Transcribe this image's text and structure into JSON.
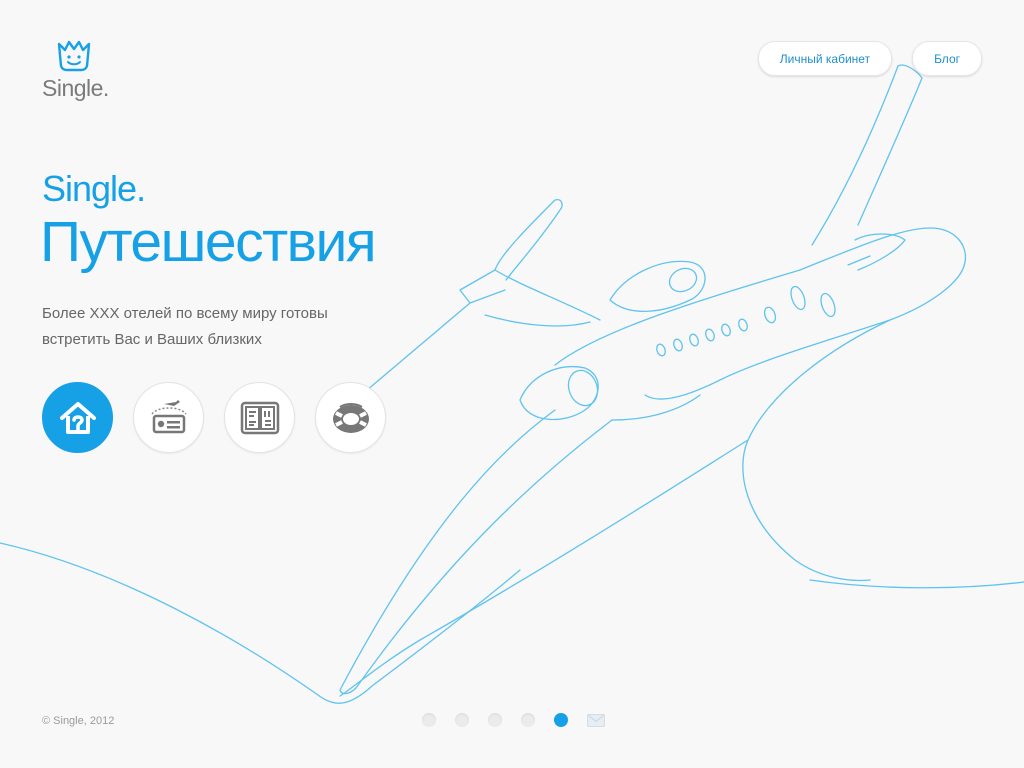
{
  "brand": {
    "name": "Single."
  },
  "nav": {
    "account_label": "Личный кабинет",
    "blog_label": "Блог"
  },
  "hero": {
    "subtitle": "Single.",
    "title": "Путешествия",
    "description_line1": "Более XXX отелей по всему миру готовы",
    "description_line2": "встретить Вас и Ваших близких"
  },
  "features": [
    {
      "icon": "house-icon",
      "active": true
    },
    {
      "icon": "flight-ticket-icon",
      "active": false
    },
    {
      "icon": "doors-icon",
      "active": false
    },
    {
      "icon": "lifebuoy-icon",
      "active": false
    }
  ],
  "footer": {
    "copyright": "© Single, 2012"
  },
  "pager": {
    "count": 5,
    "active_index": 4,
    "extra_icon": "mail-icon"
  },
  "colors": {
    "accent": "#16a1e6",
    "background": "#f8f8f8",
    "line_art": "#5fc3ee"
  }
}
